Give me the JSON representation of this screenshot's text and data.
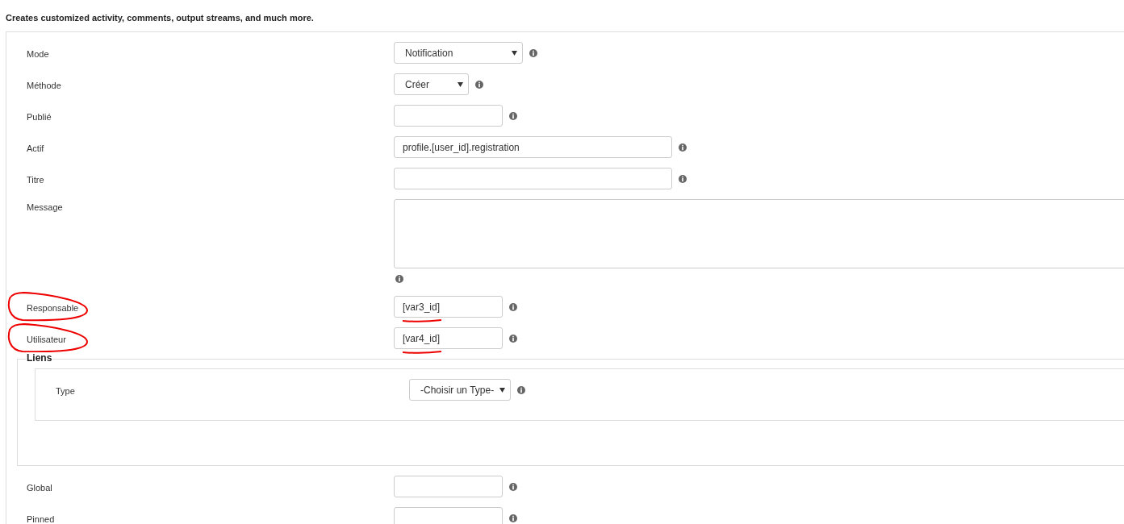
{
  "description": "Creates customized activity, comments, output streams, and much more.",
  "fields": [
    {
      "kind": "select",
      "label": "Mode",
      "value": "Notification",
      "annotated": false
    },
    {
      "kind": "select",
      "label": "Méthode",
      "value": "Créer",
      "annotated": false
    },
    {
      "kind": "input",
      "label": "Publié",
      "annotated": false
    },
    {
      "kind": "input",
      "label": "Actif",
      "value": "profile.[user_id].registration",
      "annotated": false
    },
    {
      "kind": "input",
      "label": "Titre",
      "annotated": false
    },
    {
      "kind": "textarea",
      "label": "Message",
      "annotated": false
    },
    {
      "kind": "input",
      "label": "Responsable",
      "value": "[var3_id]",
      "annotated": true
    },
    {
      "kind": "input",
      "label": "Utilisateur",
      "value": "[var4_id]",
      "annotated": true
    }
  ],
  "links": {
    "legend": "Liens",
    "fields": [
      {
        "kind": "select",
        "label": "Type",
        "value": "-Choisir un Type-"
      }
    ]
  },
  "after_fields": [
    {
      "kind": "input",
      "label": "Global",
      "annotated": false
    },
    {
      "kind": "input",
      "label": "Pinned",
      "annotated": false
    }
  ]
}
